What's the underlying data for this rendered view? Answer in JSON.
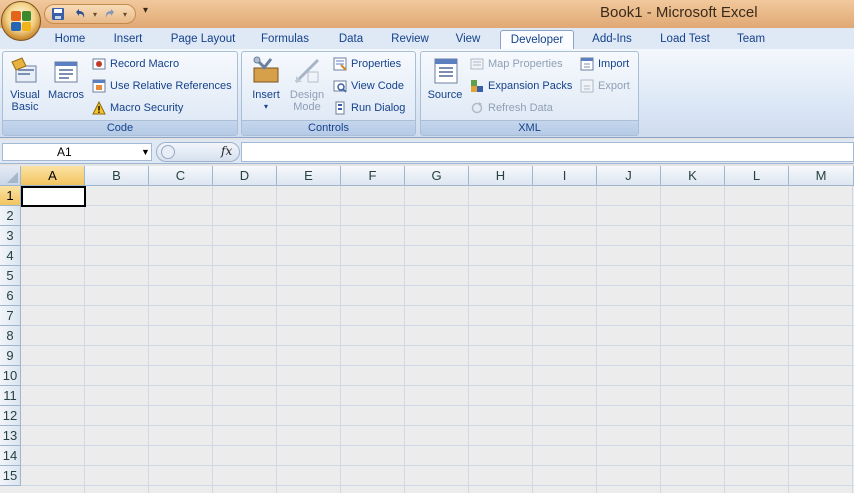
{
  "window": {
    "title": "Book1 - Microsoft Excel"
  },
  "quick_access": {
    "buttons": [
      {
        "name": "save-icon"
      },
      {
        "name": "undo-icon"
      },
      {
        "name": "redo-icon"
      }
    ],
    "more": "▾"
  },
  "tabs": [
    {
      "label": "Home",
      "active": false
    },
    {
      "label": "Insert",
      "active": false
    },
    {
      "label": "Page Layout",
      "active": false
    },
    {
      "label": "Formulas",
      "active": false
    },
    {
      "label": "Data",
      "active": false
    },
    {
      "label": "Review",
      "active": false
    },
    {
      "label": "View",
      "active": false
    },
    {
      "label": "Developer",
      "active": true
    },
    {
      "label": "Add-Ins",
      "active": false
    },
    {
      "label": "Load Test",
      "active": false
    },
    {
      "label": "Team",
      "active": false
    }
  ],
  "ribbon": {
    "code": {
      "label": "Code",
      "visual_basic": "Visual Basic",
      "visual_basic_line1": "Visual",
      "visual_basic_line2": "Basic",
      "macros": "Macros",
      "record_macro": "Record Macro",
      "use_relative_references": "Use Relative References",
      "macro_security": "Macro Security"
    },
    "controls": {
      "label": "Controls",
      "insert": "Insert",
      "design_mode_line1": "Design",
      "design_mode_line2": "Mode",
      "properties": "Properties",
      "view_code": "View Code",
      "run_dialog": "Run Dialog"
    },
    "xml": {
      "label": "XML",
      "source": "Source",
      "map_properties": "Map Properties",
      "expansion_packs": "Expansion Packs",
      "refresh_data": "Refresh Data",
      "import": "Import",
      "export": "Export"
    }
  },
  "formula_bar": {
    "name_box": "A1",
    "fx": "fx",
    "formula": ""
  },
  "sheet": {
    "columns": [
      "A",
      "B",
      "C",
      "D",
      "E",
      "F",
      "G",
      "H",
      "I",
      "J",
      "K",
      "L",
      "M"
    ],
    "rows": [
      "1",
      "2",
      "3",
      "4",
      "5",
      "6",
      "7",
      "8",
      "9",
      "10",
      "11",
      "12",
      "13",
      "14",
      "15"
    ],
    "active_cell": "A1"
  },
  "colors": {
    "accent": "#15428b",
    "title_bar": "#e0a874",
    "selected_header": "#f2c45f"
  }
}
